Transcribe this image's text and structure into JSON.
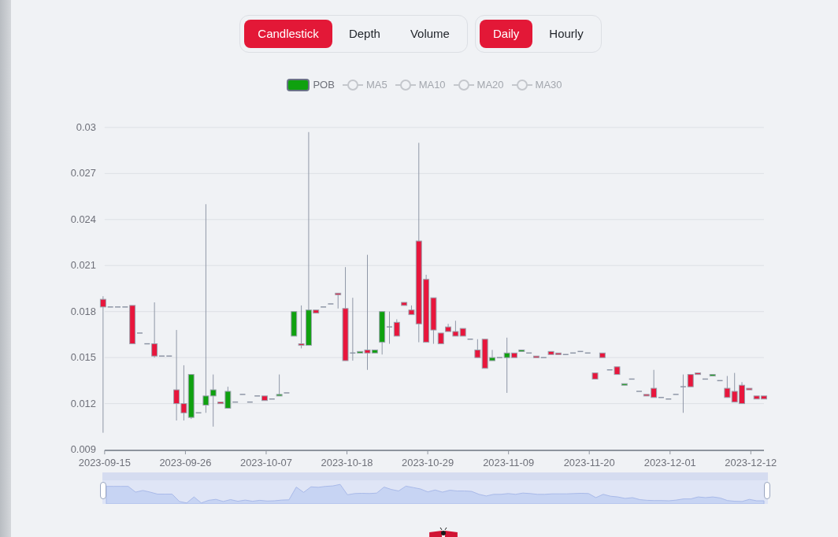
{
  "chart_types": [
    {
      "label": "Candlestick",
      "selected": true
    },
    {
      "label": "Depth",
      "selected": false
    },
    {
      "label": "Volume",
      "selected": false
    }
  ],
  "intervals": [
    {
      "label": "Daily",
      "selected": true
    },
    {
      "label": "Hourly",
      "selected": false
    }
  ],
  "legend": [
    {
      "label": "MA5",
      "kind": "line",
      "on": false
    },
    {
      "label": "MA10",
      "kind": "line",
      "on": false
    },
    {
      "label": "MA20",
      "kind": "line",
      "on": false
    },
    {
      "label": "MA30",
      "kind": "line",
      "on": false
    }
  ],
  "chart_data": {
    "type": "candlestick",
    "ylim": [
      0.009,
      0.03
    ],
    "yticks": [
      0.03,
      0.027,
      0.024,
      0.021,
      0.018,
      0.015,
      0.012,
      0.009
    ],
    "grid": true,
    "categories": [
      "2023-09-15",
      null,
      null,
      null,
      null,
      null,
      null,
      null,
      null,
      null,
      null,
      "2023-09-26",
      null,
      null,
      null,
      null,
      null,
      null,
      null,
      null,
      null,
      null,
      "2023-10-07",
      null,
      null,
      null,
      null,
      null,
      null,
      null,
      null,
      null,
      null,
      "2023-10-18",
      null,
      null,
      null,
      null,
      null,
      null,
      null,
      null,
      null,
      null,
      "2023-10-29",
      null,
      null,
      null,
      null,
      null,
      null,
      null,
      null,
      null,
      null,
      "2023-11-09",
      null,
      null,
      null,
      null,
      null,
      null,
      null,
      null,
      null,
      null,
      "2023-11-20",
      null,
      null,
      null,
      null,
      null,
      null,
      null,
      null,
      null,
      null,
      "2023-12-01",
      null,
      null,
      null,
      null,
      null,
      null,
      null,
      null,
      null,
      null,
      "2023-12-12",
      null,
      null
    ],
    "series": [
      {
        "name": "POB",
        "ohlc": [
          [
            0.0188,
            0.019,
            0.0101,
            0.0183
          ],
          [
            0.0183,
            0.0183,
            0.0183,
            0.0183
          ],
          [
            0.0183,
            0.0183,
            0.0183,
            0.0183
          ],
          [
            0.0183,
            0.0183,
            0.0183,
            0.0183
          ],
          [
            0.0184,
            0.0184,
            0.0159,
            0.0159
          ],
          [
            0.0166,
            0.0166,
            0.0166,
            0.0166
          ],
          [
            0.0159,
            0.0159,
            0.0159,
            0.0159
          ],
          [
            0.0159,
            0.0186,
            0.015,
            0.0151
          ],
          [
            0.0151,
            0.0151,
            0.0151,
            0.0151
          ],
          [
            0.0151,
            0.0151,
            0.0151,
            0.0151
          ],
          [
            0.0129,
            0.0168,
            0.0109,
            0.012
          ],
          [
            0.012,
            0.0145,
            0.0109,
            0.0114
          ],
          [
            0.0111,
            0.0139,
            0.011,
            0.0139
          ],
          [
            0.0114,
            0.0114,
            0.0114,
            0.0114
          ],
          [
            0.0119,
            0.025,
            0.0114,
            0.0125
          ],
          [
            0.0125,
            0.0139,
            0.0105,
            0.0129
          ],
          [
            0.0121,
            0.0121,
            0.012,
            0.012
          ],
          [
            0.0117,
            0.0131,
            0.0117,
            0.0128
          ],
          [
            0.0121,
            0.0121,
            0.0121,
            0.0121
          ],
          [
            0.0126,
            0.0126,
            0.0126,
            0.0126
          ],
          [
            0.0121,
            0.0121,
            0.0121,
            0.0121
          ],
          [
            0.0125,
            0.0125,
            0.0125,
            0.0125
          ],
          [
            0.0125,
            0.0125,
            0.0122,
            0.0122
          ],
          [
            0.0123,
            0.0123,
            0.0123,
            0.0123
          ],
          [
            0.0125,
            0.0139,
            0.0125,
            0.0126
          ],
          [
            0.0127,
            0.0127,
            0.0127,
            0.0127
          ],
          [
            0.0164,
            0.018,
            0.0164,
            0.018
          ],
          [
            0.0159,
            0.0184,
            0.0156,
            0.0158
          ],
          [
            0.0158,
            0.0297,
            0.0158,
            0.0181
          ],
          [
            0.0181,
            0.0181,
            0.0179,
            0.0179
          ],
          [
            0.0183,
            0.0183,
            0.0183,
            0.0183
          ],
          [
            0.0185,
            0.0185,
            0.0185,
            0.0185
          ],
          [
            0.0192,
            0.0192,
            0.0182,
            0.0191
          ],
          [
            0.0182,
            0.0209,
            0.0148,
            0.0148
          ],
          [
            0.0153,
            0.0189,
            0.0148,
            0.0153
          ],
          [
            0.0153,
            0.0154,
            0.0153,
            0.0154
          ],
          [
            0.0155,
            0.0217,
            0.0142,
            0.0153
          ],
          [
            0.0153,
            0.0155,
            0.0153,
            0.0155
          ],
          [
            0.016,
            0.018,
            0.0152,
            0.018
          ],
          [
            0.017,
            0.018,
            0.0159,
            0.017
          ],
          [
            0.0173,
            0.0175,
            0.0164,
            0.0164
          ],
          [
            0.0186,
            0.0186,
            0.0184,
            0.0184
          ],
          [
            0.0181,
            0.0184,
            0.0178,
            0.0178
          ],
          [
            0.0226,
            0.029,
            0.016,
            0.0172
          ],
          [
            0.0201,
            0.0204,
            0.016,
            0.016
          ],
          [
            0.0189,
            0.0189,
            0.0159,
            0.0168
          ],
          [
            0.0166,
            0.0166,
            0.0159,
            0.0159
          ],
          [
            0.017,
            0.0172,
            0.0167,
            0.0167
          ],
          [
            0.0167,
            0.0174,
            0.0164,
            0.0164
          ],
          [
            0.0169,
            0.0169,
            0.0164,
            0.0164
          ],
          [
            0.0162,
            0.0162,
            0.0162,
            0.0162
          ],
          [
            0.0155,
            0.0162,
            0.015,
            0.015
          ],
          [
            0.0162,
            0.0162,
            0.0143,
            0.0143
          ],
          [
            0.0148,
            0.0155,
            0.0148,
            0.015
          ],
          [
            0.015,
            0.015,
            0.015,
            0.015
          ],
          [
            0.015,
            0.0163,
            0.0127,
            0.0153
          ],
          [
            0.0153,
            0.0153,
            0.015,
            0.015
          ],
          [
            0.0154,
            0.0155,
            0.0154,
            0.0155
          ],
          [
            0.0153,
            0.0153,
            0.0153,
            0.0153
          ],
          [
            0.0151,
            0.0151,
            0.015,
            0.015
          ],
          [
            0.015,
            0.015,
            0.015,
            0.015
          ],
          [
            0.0154,
            0.0154,
            0.0152,
            0.0152
          ],
          [
            0.0153,
            0.0153,
            0.0152,
            0.0152
          ],
          [
            0.0152,
            0.0152,
            0.0152,
            0.0152
          ],
          [
            0.0153,
            0.0153,
            0.0153,
            0.0153
          ],
          [
            0.0154,
            0.0154,
            0.0154,
            0.0154
          ],
          [
            0.0153,
            0.0153,
            0.0153,
            0.0153
          ],
          [
            0.014,
            0.014,
            0.0136,
            0.0136
          ],
          [
            0.0153,
            0.0153,
            0.015,
            0.015
          ],
          [
            0.0142,
            0.0142,
            0.0142,
            0.0142
          ],
          [
            0.0144,
            0.0144,
            0.0139,
            0.0139
          ],
          [
            0.0132,
            0.0133,
            0.0132,
            0.0133
          ],
          [
            0.0136,
            0.0136,
            0.0136,
            0.0136
          ],
          [
            0.0128,
            0.0128,
            0.0128,
            0.0128
          ],
          [
            0.0126,
            0.0126,
            0.0125,
            0.0125
          ],
          [
            0.013,
            0.0142,
            0.0124,
            0.0124
          ],
          [
            0.0124,
            0.0124,
            0.0124,
            0.0124
          ],
          [
            0.0123,
            0.0123,
            0.0123,
            0.0123
          ],
          [
            0.0126,
            0.0126,
            0.0126,
            0.0126
          ],
          [
            0.0131,
            0.0139,
            0.0114,
            0.0131
          ],
          [
            0.0139,
            0.0139,
            0.0131,
            0.0131
          ],
          [
            0.014,
            0.014,
            0.0139,
            0.0139
          ],
          [
            0.0136,
            0.0136,
            0.0136,
            0.0136
          ],
          [
            0.0138,
            0.0139,
            0.0138,
            0.0139
          ],
          [
            0.0135,
            0.0135,
            0.0135,
            0.0135
          ],
          [
            0.013,
            0.0138,
            0.0124,
            0.0124
          ],
          [
            0.0128,
            0.014,
            0.0121,
            0.0121
          ],
          [
            0.0132,
            0.0134,
            0.012,
            0.012
          ],
          [
            0.013,
            0.013,
            0.0129,
            0.0129
          ],
          [
            0.0125,
            0.0125,
            0.0123,
            0.0123
          ],
          [
            0.0125,
            0.0125,
            0.0123,
            0.0123
          ]
        ]
      }
    ]
  },
  "zoom_range": [
    {
      "level": 0
    },
    {
      "level": 1
    }
  ]
}
